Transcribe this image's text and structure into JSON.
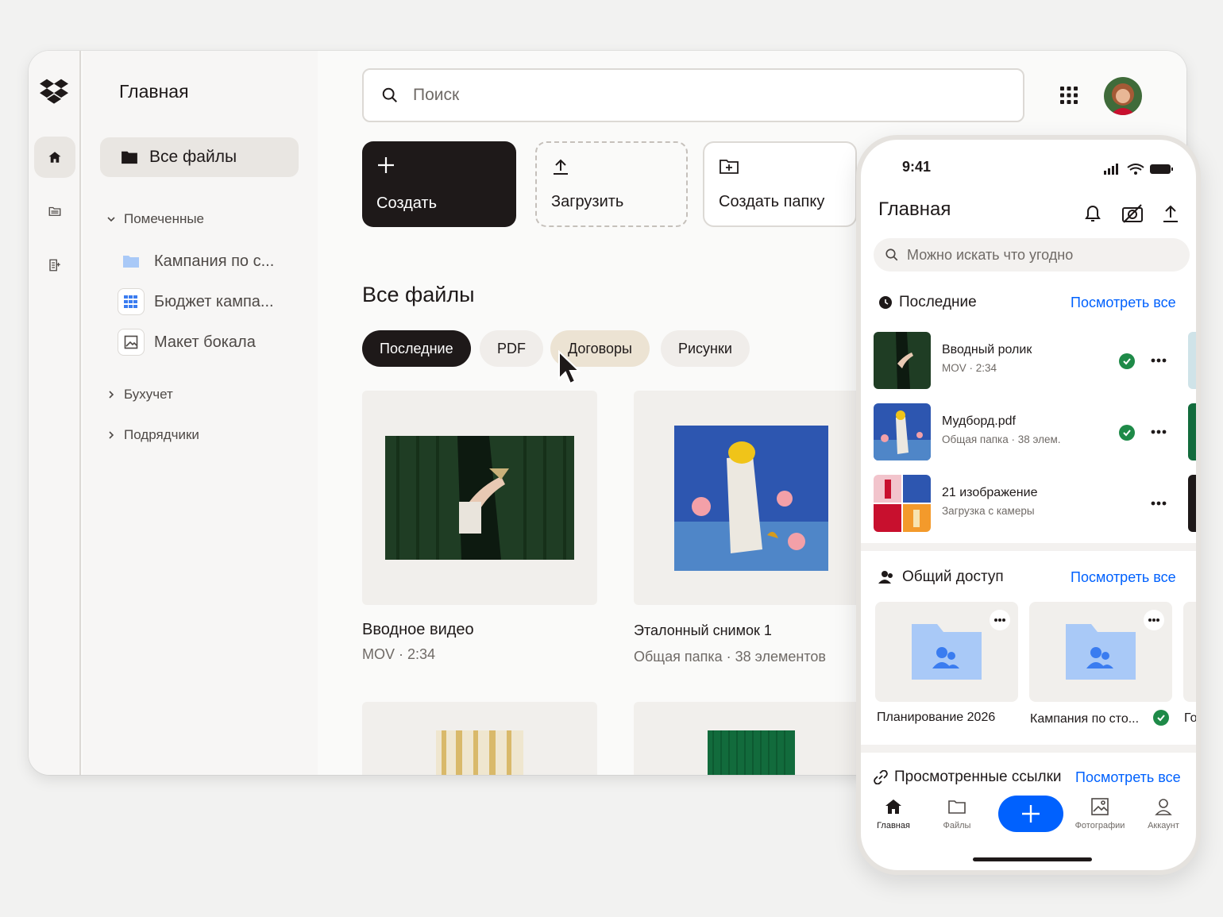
{
  "sidebar": {
    "title": "Главная",
    "all_files": "Все файлы",
    "starred": "Помеченные",
    "starred_items": [
      "Кампания по с...",
      "Бюджет кампа...",
      "Макет бокала"
    ],
    "sections": [
      "Бухучет",
      "Подрядчики"
    ]
  },
  "search": {
    "placeholder": "Поиск"
  },
  "actions": {
    "create": "Создать",
    "upload": "Загрузить",
    "new_folder": "Создать папку"
  },
  "main": {
    "title": "Все файлы",
    "chips": [
      "Последние",
      "PDF",
      "Договоры",
      "Рисунки"
    ],
    "cards": [
      {
        "title": "Вводное видео",
        "subtitle": "MOV · 2:34"
      },
      {
        "title": "Эталонный снимок 1",
        "subtitle": "Общая папка · 38 элементов"
      }
    ]
  },
  "phone": {
    "time": "9:41",
    "title": "Главная",
    "search_placeholder": "Можно искать что угодно",
    "recent": {
      "title": "Последние",
      "link": "Посмотреть все",
      "items": [
        {
          "title": "Вводный ролик",
          "subtitle": "MOV · 2:34"
        },
        {
          "title": "Мудборд.pdf",
          "subtitle": "Общая папка · 38 элем."
        },
        {
          "title": "21 изображение",
          "subtitle": "Загрузка с камеры"
        }
      ]
    },
    "shared": {
      "title": "Общий доступ",
      "link": "Посмотреть все",
      "items": [
        "Планирование 2026",
        "Кампания по сто...",
        "Го"
      ]
    },
    "links": {
      "title": "Просмотренные ссылки",
      "link": "Посмотреть все"
    },
    "nav": [
      "Главная",
      "Файлы",
      "Фотографии",
      "Аккаунт"
    ]
  },
  "colors": {
    "accent": "#0061fe",
    "dark": "#1e1919",
    "success": "#1e8a48",
    "folder": "#a9c9f7"
  },
  "icons": [
    "dropbox-logo-icon",
    "home-icon",
    "folder-icon",
    "search-icon",
    "apps-grid-icon",
    "plus-icon",
    "upload-icon",
    "folder-plus-icon",
    "bell-icon",
    "camera-off-icon",
    "link-icon",
    "photos-icon",
    "account-icon"
  ]
}
